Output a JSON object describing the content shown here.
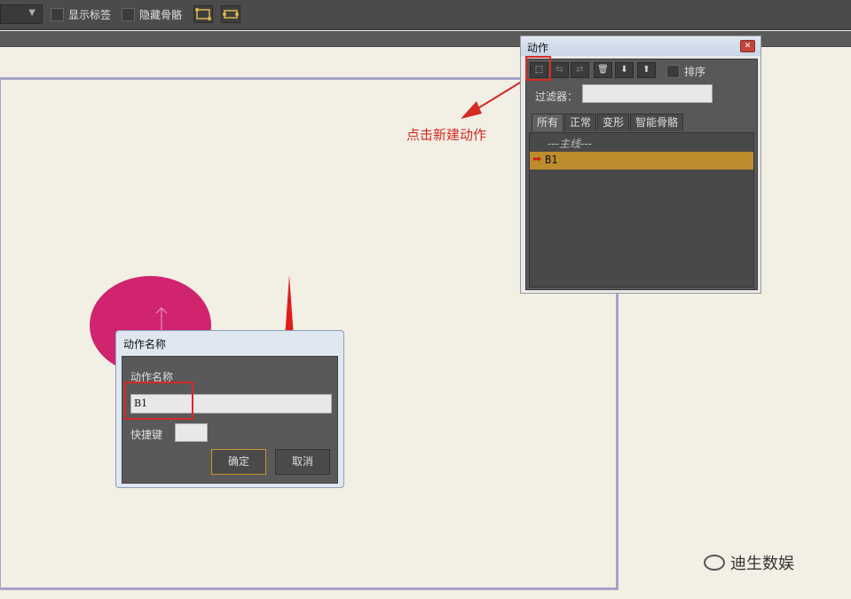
{
  "toolbar": {
    "dropdown_icon": "chevron-down-icon",
    "show_labels": "显示标签",
    "hide_bones": "隐藏骨骼",
    "icon1": "bone-bind-icon",
    "icon2": "bone-unbind-icon"
  },
  "annotation": {
    "text": "点击新建动作",
    "color": "#d42a24"
  },
  "actions_panel": {
    "title": "动作",
    "close_icon": "close-icon",
    "tools": [
      "new-action-icon",
      "duplicate-action-icon",
      "rename-action-icon",
      "delete-action-icon",
      "import-action-icon",
      "export-action-icon"
    ],
    "sort_label": "排序",
    "filter_label": "过滤器：",
    "filter_value": "",
    "tabs": [
      "所有",
      "正常",
      "变形",
      "智能骨骼"
    ],
    "group": "---主线---",
    "items": [
      {
        "name": "B1",
        "selected": true
      }
    ],
    "selected_color": "#bd8c2c"
  },
  "dialog": {
    "title": "动作名称",
    "name_label": "动作名称",
    "name_value": "B1",
    "shortcut_label": "快捷键",
    "shortcut_value": "",
    "ok_label": "确定",
    "cancel_label": "取消"
  },
  "watermark": {
    "text": "迪生数娱"
  },
  "colors": {
    "stage_border": "#a7a2c9",
    "shape_fill": "#d0246e",
    "highlight": "#d62b26"
  }
}
